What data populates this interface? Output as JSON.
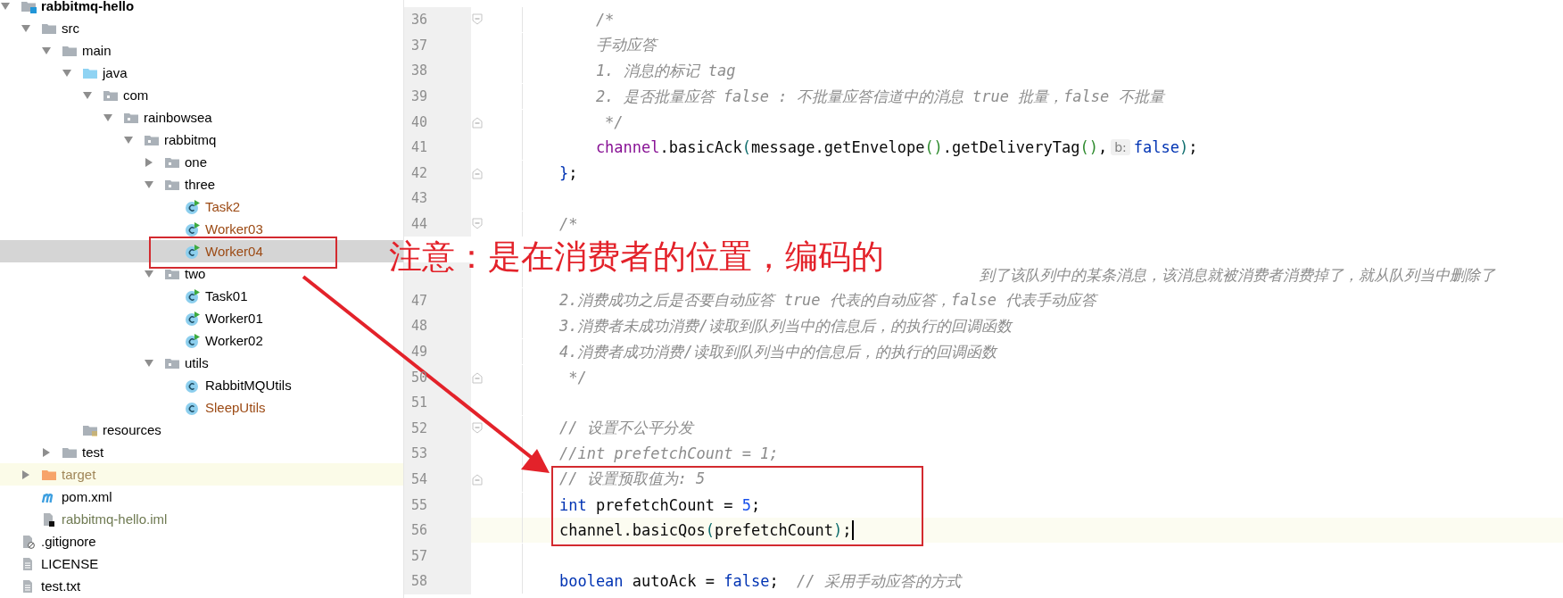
{
  "project_tree": {
    "items": [
      {
        "label": "rabbitmq-hello",
        "kind": "module",
        "expanded": true,
        "selected": false,
        "color": "#000000",
        "children": [
          {
            "label": "src",
            "kind": "folder",
            "expanded": true,
            "selected": false,
            "color": "#000000",
            "children": [
              {
                "label": "main",
                "kind": "folder",
                "expanded": true,
                "selected": false,
                "color": "#000000",
                "children": [
                  {
                    "label": "java",
                    "kind": "source_folder",
                    "expanded": true,
                    "selected": false,
                    "color": "#000000",
                    "children": [
                      {
                        "label": "com",
                        "kind": "package",
                        "expanded": true,
                        "selected": false,
                        "color": "#000000",
                        "children": [
                          {
                            "label": "rainbowsea",
                            "kind": "package",
                            "expanded": true,
                            "selected": false,
                            "color": "#000000",
                            "children": [
                              {
                                "label": "rabbitmq",
                                "kind": "package",
                                "expanded": true,
                                "selected": false,
                                "color": "#000000",
                                "children": [
                                  {
                                    "label": "one",
                                    "kind": "package",
                                    "expanded": false,
                                    "selected": false,
                                    "color": "#000000"
                                  },
                                  {
                                    "label": "three",
                                    "kind": "package",
                                    "expanded": true,
                                    "selected": false,
                                    "color": "#000000",
                                    "children": [
                                      {
                                        "label": "Task2",
                                        "kind": "class",
                                        "runnable": true,
                                        "selected": false,
                                        "color": "#9c4a14"
                                      },
                                      {
                                        "label": "Worker03",
                                        "kind": "class",
                                        "runnable": true,
                                        "selected": false,
                                        "color": "#9c4a14"
                                      },
                                      {
                                        "label": "Worker04",
                                        "kind": "class",
                                        "runnable": true,
                                        "selected": true,
                                        "color": "#9c4a14"
                                      }
                                    ]
                                  },
                                  {
                                    "label": "two",
                                    "kind": "package",
                                    "expanded": true,
                                    "selected": false,
                                    "color": "#000000",
                                    "children": [
                                      {
                                        "label": "Task01",
                                        "kind": "class",
                                        "runnable": true,
                                        "selected": false,
                                        "color": "#000000"
                                      },
                                      {
                                        "label": "Worker01",
                                        "kind": "class",
                                        "runnable": true,
                                        "selected": false,
                                        "color": "#000000"
                                      },
                                      {
                                        "label": "Worker02",
                                        "kind": "class",
                                        "runnable": true,
                                        "selected": false,
                                        "color": "#000000"
                                      }
                                    ]
                                  },
                                  {
                                    "label": "utils",
                                    "kind": "package",
                                    "expanded": true,
                                    "selected": false,
                                    "color": "#000000",
                                    "children": [
                                      {
                                        "label": "RabbitMQUtils",
                                        "kind": "class",
                                        "runnable": false,
                                        "selected": false,
                                        "color": "#000000"
                                      },
                                      {
                                        "label": "SleepUtils",
                                        "kind": "class",
                                        "runnable": false,
                                        "selected": false,
                                        "color": "#9c4a14"
                                      }
                                    ]
                                  }
                                ]
                              }
                            ]
                          }
                        ]
                      }
                    ]
                  },
                  {
                    "label": "resources",
                    "kind": "resources_folder",
                    "selected": false,
                    "color": "#000000"
                  }
                ]
              },
              {
                "label": "test",
                "kind": "folder",
                "expanded": false,
                "selected": false,
                "color": "#000000"
              }
            ]
          },
          {
            "label": "target",
            "kind": "excluded_folder",
            "expanded": false,
            "selected": false,
            "color": "#a08658"
          },
          {
            "label": "pom.xml",
            "kind": "maven",
            "selected": false,
            "color": "#000000"
          },
          {
            "label": "rabbitmq-hello.iml",
            "kind": "iml",
            "selected": false,
            "color": "#6f7a52"
          }
        ]
      },
      {
        "label": ".gitignore",
        "kind": "gitignore",
        "selected": false,
        "color": "#000000"
      },
      {
        "label": "LICENSE",
        "kind": "text_file",
        "selected": false,
        "color": "#000000"
      },
      {
        "label": "test.txt",
        "kind": "text_file",
        "selected": false,
        "color": "#000000"
      }
    ]
  },
  "editor": {
    "lines": [
      {
        "number": "36",
        "fold_open": true,
        "fold_close": false,
        "current": false,
        "tokens": [
          {
            "t": "        /*",
            "kind": "comment"
          }
        ]
      },
      {
        "number": "37",
        "fold_open": false,
        "fold_close": false,
        "current": false,
        "tokens": [
          {
            "t": "        手动应答",
            "kind": "comment"
          }
        ]
      },
      {
        "number": "38",
        "fold_open": false,
        "fold_close": false,
        "current": false,
        "tokens": [
          {
            "t": "        1. 消息的标记 tag",
            "kind": "comment"
          }
        ]
      },
      {
        "number": "39",
        "fold_open": false,
        "fold_close": false,
        "current": false,
        "tokens": [
          {
            "t": "        2. 是否批量应答 false : 不批量应答信道中的消息 true 批量，false 不批量",
            "kind": "comment"
          }
        ]
      },
      {
        "number": "40",
        "fold_open": false,
        "fold_close": true,
        "current": false,
        "tokens": [
          {
            "t": "         */",
            "kind": "comment"
          }
        ]
      },
      {
        "number": "41",
        "fold_open": false,
        "fold_close": false,
        "current": false,
        "tokens": [
          {
            "t": "        channel",
            "kind": "field"
          },
          {
            "t": ".basicAck",
            "kind": "plain"
          },
          {
            "t": "(",
            "kind": "paren"
          },
          {
            "t": "message.getEnvelope",
            "kind": "plain"
          },
          {
            "t": "()",
            "kind": "paren2"
          },
          {
            "t": ".getDeliveryTag",
            "kind": "plain"
          },
          {
            "t": "()",
            "kind": "paren2"
          },
          {
            "t": ",",
            "kind": "plain"
          },
          {
            "t": "b:",
            "kind": "hint"
          },
          {
            "t": "false",
            "kind": "keyword"
          },
          {
            "t": ")",
            "kind": "paren"
          },
          {
            "t": ";",
            "kind": "plain"
          }
        ]
      },
      {
        "number": "42",
        "fold_open": false,
        "fold_close": true,
        "current": false,
        "tokens": [
          {
            "t": "    }",
            "kind": "brace"
          },
          {
            "t": ";",
            "kind": "plain"
          }
        ]
      },
      {
        "number": "43",
        "fold_open": false,
        "fold_close": false,
        "current": false
      },
      {
        "number": "44",
        "fold_open": true,
        "fold_close": false,
        "current": false,
        "tokens": [
          {
            "t": "    /*",
            "kind": "comment"
          }
        ]
      },
      {
        "current": false,
        "tokens": [
          {
            "t": "到了该队列中的某条消息，该消息就被消费者消费掉了，就从队列当中删除了",
            "kind": "covered_comment"
          }
        ]
      },
      {
        "number": "47",
        "fold_open": false,
        "fold_close": false,
        "current": false,
        "tokens": [
          {
            "t": "    2.消费成功之后是否要自动应答 true 代表的自动应答，false 代表手动应答",
            "kind": "comment"
          }
        ]
      },
      {
        "number": "48",
        "fold_open": false,
        "fold_close": false,
        "current": false,
        "tokens": [
          {
            "t": "    3.消费者未成功消费/读取到队列当中的信息后，的执行的回调函数",
            "kind": "comment"
          }
        ]
      },
      {
        "number": "49",
        "fold_open": false,
        "fold_close": false,
        "current": false,
        "tokens": [
          {
            "t": "    4.消费者成功消费/读取到队列当中的信息后，的执行的回调函数",
            "kind": "comment"
          }
        ]
      },
      {
        "number": "50",
        "fold_open": false,
        "fold_close": true,
        "current": false,
        "tokens": [
          {
            "t": "     */",
            "kind": "comment"
          }
        ]
      },
      {
        "number": "51",
        "fold_open": false,
        "fold_close": false,
        "current": false
      },
      {
        "number": "52",
        "fold_open": true,
        "fold_close": false,
        "current": false,
        "tokens": [
          {
            "t": "    // 设置不公平分发",
            "kind": "comment"
          }
        ]
      },
      {
        "number": "53",
        "fold_open": false,
        "fold_close": false,
        "current": false,
        "tokens": [
          {
            "t": "    //int prefetchCount = 1;",
            "kind": "comment"
          }
        ]
      },
      {
        "number": "54",
        "fold_open": false,
        "fold_close": true,
        "current": false,
        "tokens": [
          {
            "t": "    // 设置预取值为: 5",
            "kind": "comment"
          }
        ]
      },
      {
        "number": "55",
        "fold_open": false,
        "fold_close": false,
        "current": false,
        "tokens": [
          {
            "t": "    int",
            "kind": "keyword"
          },
          {
            "t": " prefetchCount = ",
            "kind": "plain"
          },
          {
            "t": "5",
            "kind": "number"
          },
          {
            "t": ";",
            "kind": "plain"
          }
        ]
      },
      {
        "number": "56",
        "fold_open": false,
        "fold_close": false,
        "current": true,
        "tokens": [
          {
            "t": "    channel.basicQos",
            "kind": "plain"
          },
          {
            "t": "(",
            "kind": "paren"
          },
          {
            "t": "prefetchCount",
            "kind": "plain"
          },
          {
            "t": ")",
            "kind": "paren"
          },
          {
            "t": ";",
            "kind": "plain"
          }
        ]
      },
      {
        "number": "57",
        "fold_open": false,
        "fold_close": false,
        "current": false
      },
      {
        "number": "58",
        "fold_open": false,
        "fold_close": false,
        "current": false,
        "tokens": [
          {
            "t": "    boolean",
            "kind": "keyword"
          },
          {
            "t": " autoAck = ",
            "kind": "plain"
          },
          {
            "t": "false",
            "kind": "keyword"
          },
          {
            "t": ";  ",
            "kind": "plain"
          },
          {
            "t": "// 采用手动应答的方式",
            "kind": "comment"
          }
        ]
      }
    ]
  },
  "annotation": {
    "note": "注意：是在消费者的位置，编码的"
  }
}
